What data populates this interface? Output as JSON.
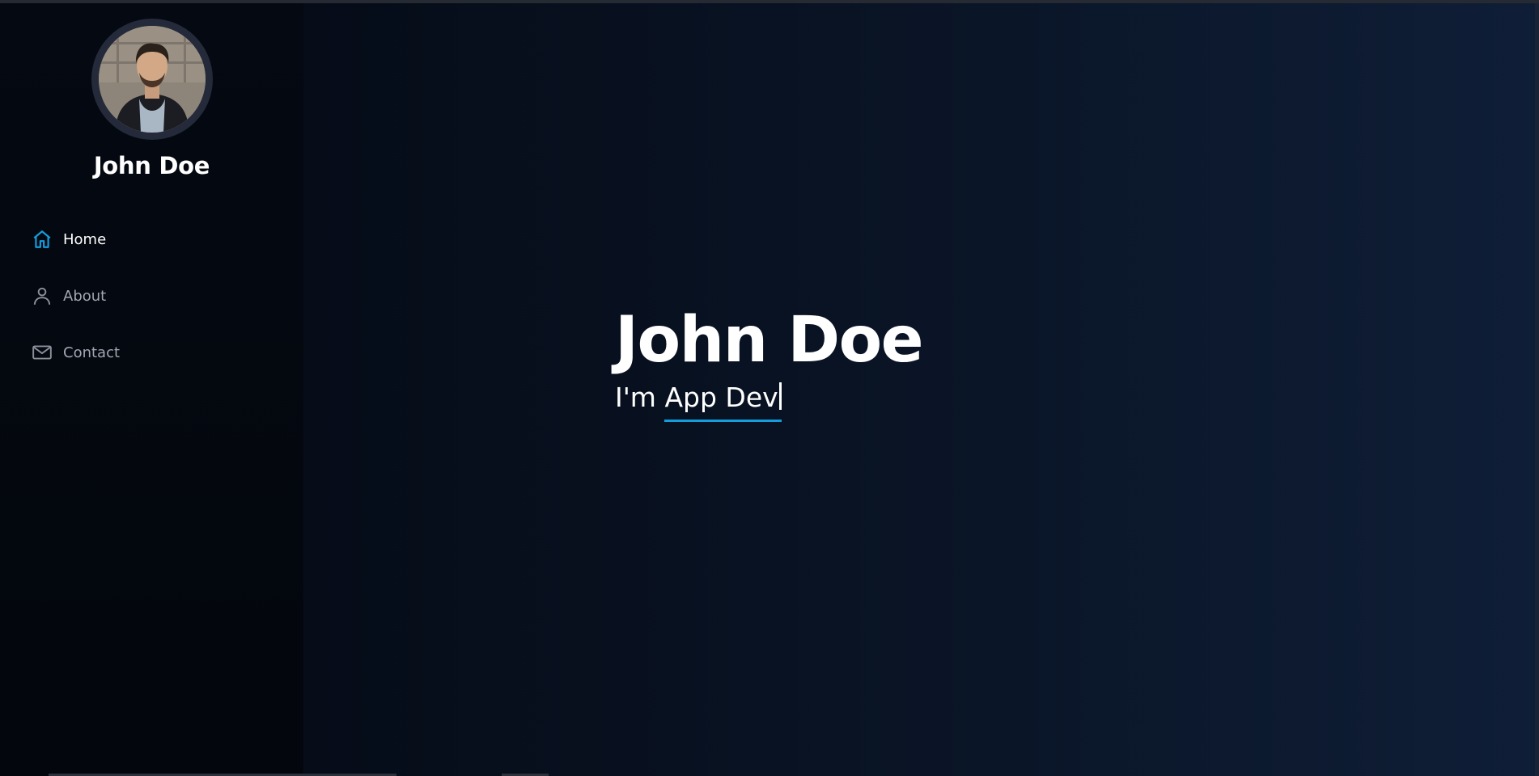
{
  "profile": {
    "name": "John Doe",
    "avatar_alt": "profile-photo"
  },
  "nav": {
    "items": [
      {
        "label": "Home",
        "icon": "home-icon",
        "active": true
      },
      {
        "label": "About",
        "icon": "person-icon",
        "active": false
      },
      {
        "label": "Contact",
        "icon": "envelope-icon",
        "active": false
      }
    ]
  },
  "hero": {
    "title": "John Doe",
    "prefix": "I'm ",
    "typed_text": "App Dev"
  },
  "colors": {
    "accent": "#149ddd",
    "sidebar_bg": "#040912",
    "hero_bg_start": "#060c18",
    "hero_bg_end": "#0f1e37",
    "nav_text": "#a3a7b0",
    "active_text": "#ffffff"
  }
}
